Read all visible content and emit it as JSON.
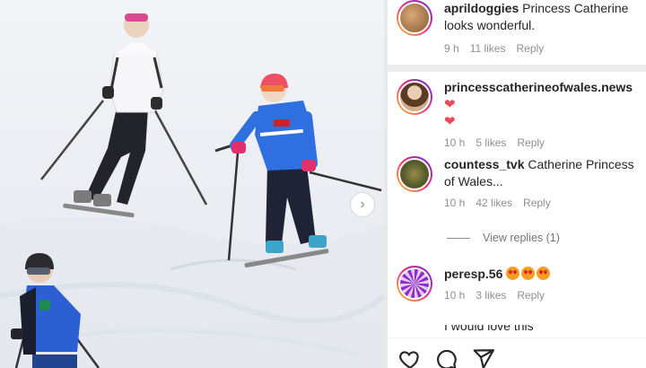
{
  "photo": {
    "description_icon": "chevron-right-icon"
  },
  "comments": [
    {
      "username": "aprildoggies",
      "text": "Princess Catherine looks wonderful.",
      "time": "9 h",
      "likes": "11 likes",
      "reply": "Reply",
      "avatar_color": "#a46b3f"
    },
    {
      "username": "princesscatherineofwales.news",
      "text": "",
      "time": "10 h",
      "likes": "5 likes",
      "reply": "Reply",
      "avatar_color": "#c7a27c"
    },
    {
      "username": "countess_tvk",
      "text": "Catherine Princess of Wales...",
      "time": "10 h",
      "likes": "42 likes",
      "reply": "Reply",
      "avatar_color": "#7a6a3a"
    },
    {
      "username": "peresp.56",
      "text": "",
      "time": "10 h",
      "likes": "3 likes",
      "reply": "Reply",
      "avatar_color": "#9b3fbf"
    }
  ],
  "view_replies": "View replies (1)",
  "partial_comment": "I would love this",
  "actions": {
    "like_icon": "heart-icon",
    "comment_icon": "comment-icon",
    "share_icon": "send-icon"
  }
}
